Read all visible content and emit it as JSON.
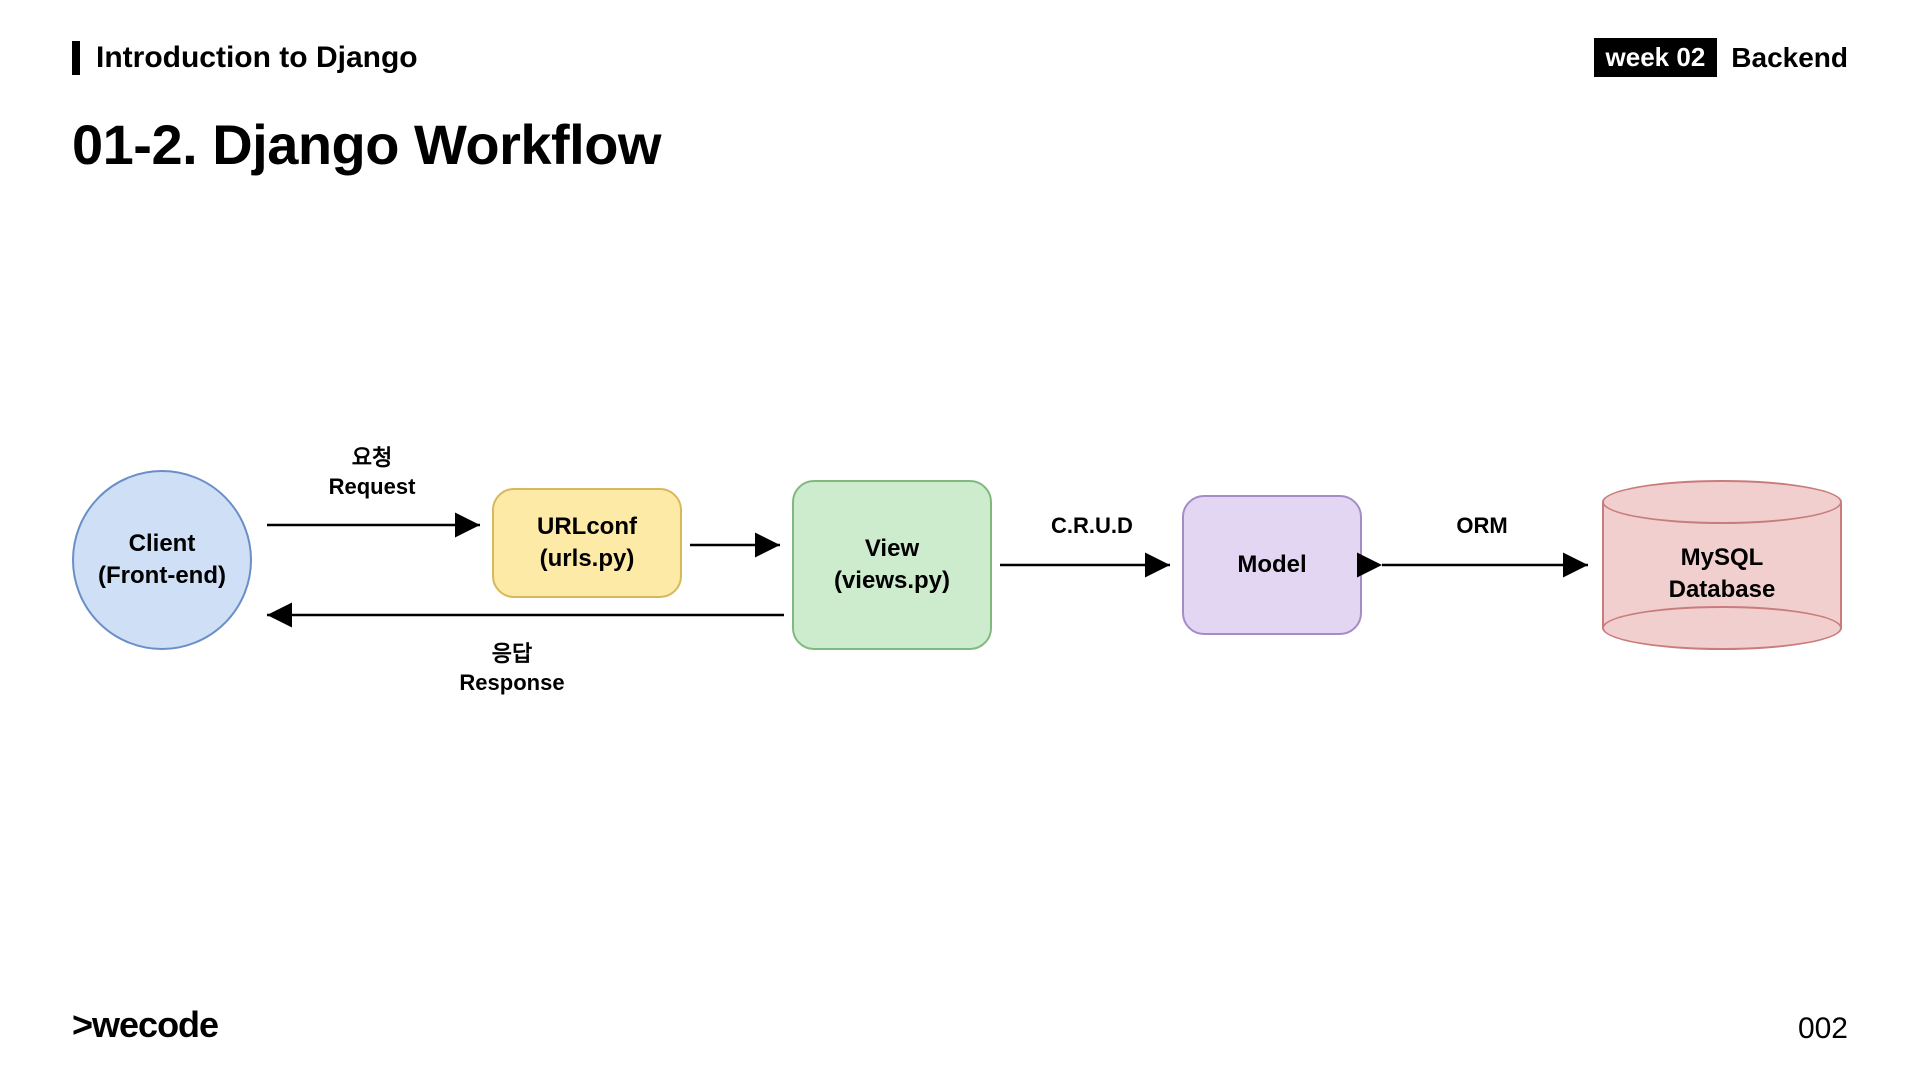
{
  "header": {
    "section": "Introduction to Django",
    "week_badge": "week 02",
    "track": "Backend"
  },
  "title": "01-2. Django Workflow",
  "footer": {
    "logo": ">wecode",
    "page": "002"
  },
  "diagram": {
    "nodes": {
      "client": {
        "line1": "Client",
        "line2": "(Front-end)"
      },
      "urlconf": {
        "line1": "URLconf",
        "line2": "(urls.py)"
      },
      "view": {
        "line1": "View",
        "line2": "(views.py)"
      },
      "model": {
        "line1": "Model"
      },
      "db": {
        "line1": "MySQL",
        "line2": "Database"
      }
    },
    "arrows": {
      "request": {
        "ko": "요청",
        "en": "Request"
      },
      "response": {
        "ko": "응답",
        "en": "Response"
      },
      "crud": "C.R.U.D",
      "orm": "ORM"
    }
  },
  "colors": {
    "client_fill": "#cfe0f6",
    "client_stroke": "#6a8ec7",
    "urlconf_fill": "#fdeaa7",
    "urlconf_stroke": "#d7b85a",
    "view_fill": "#cdeccd",
    "view_stroke": "#7fb97f",
    "model_fill": "#e2d6f3",
    "model_stroke": "#a48cc7",
    "db_fill": "#f2cfcf",
    "db_stroke": "#c97c7c"
  }
}
